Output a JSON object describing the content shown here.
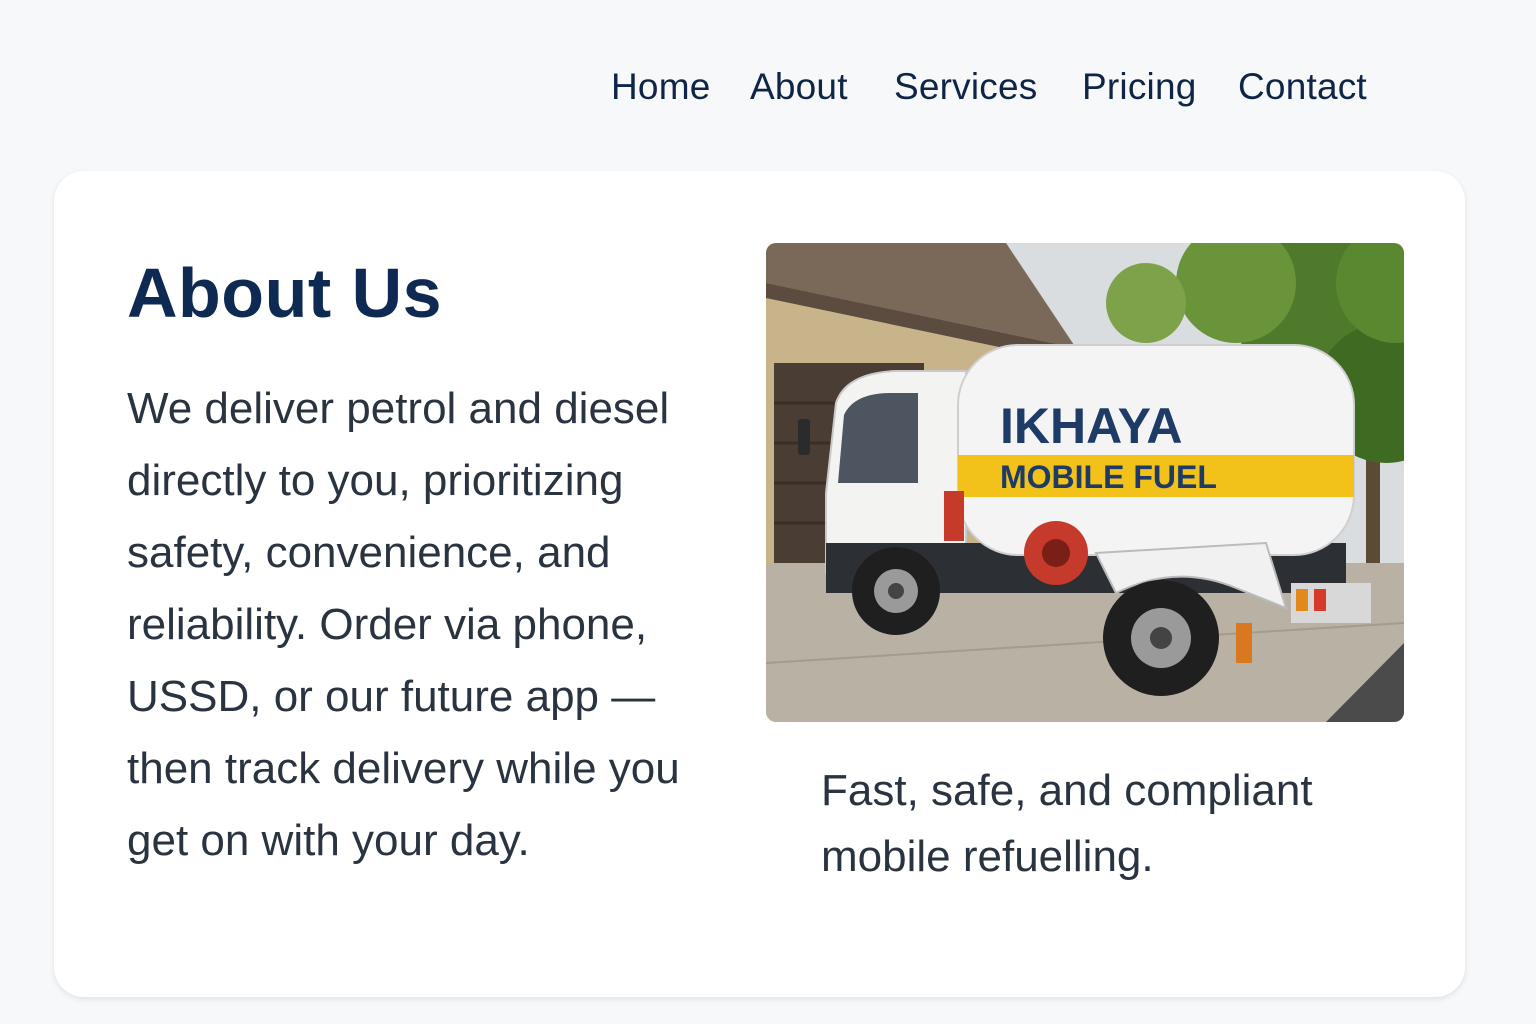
{
  "nav": {
    "items": [
      "Home",
      "About",
      "Services",
      "Pricing",
      "Contact"
    ]
  },
  "about": {
    "title": "About Us",
    "body": "We deliver petrol and diesel directly to you, prioritizing safety, convenience, and reliability. Order via phone, USSD, or our future app — then track delivery while you get on with your day.",
    "image_caption": "Fast, safe, and compliant mobile refuelling.",
    "truck_brand": "IKHAYA",
    "truck_tagline": "MOBILE FUEL"
  },
  "colors": {
    "page_bg": "#f7f8fa",
    "card_bg": "#ffffff",
    "heading": "#0e2a52",
    "nav_text": "#0f2547",
    "body_text": "#2a3340",
    "brand_yellow": "#f2c21b",
    "brand_navy": "#1d3b66"
  }
}
